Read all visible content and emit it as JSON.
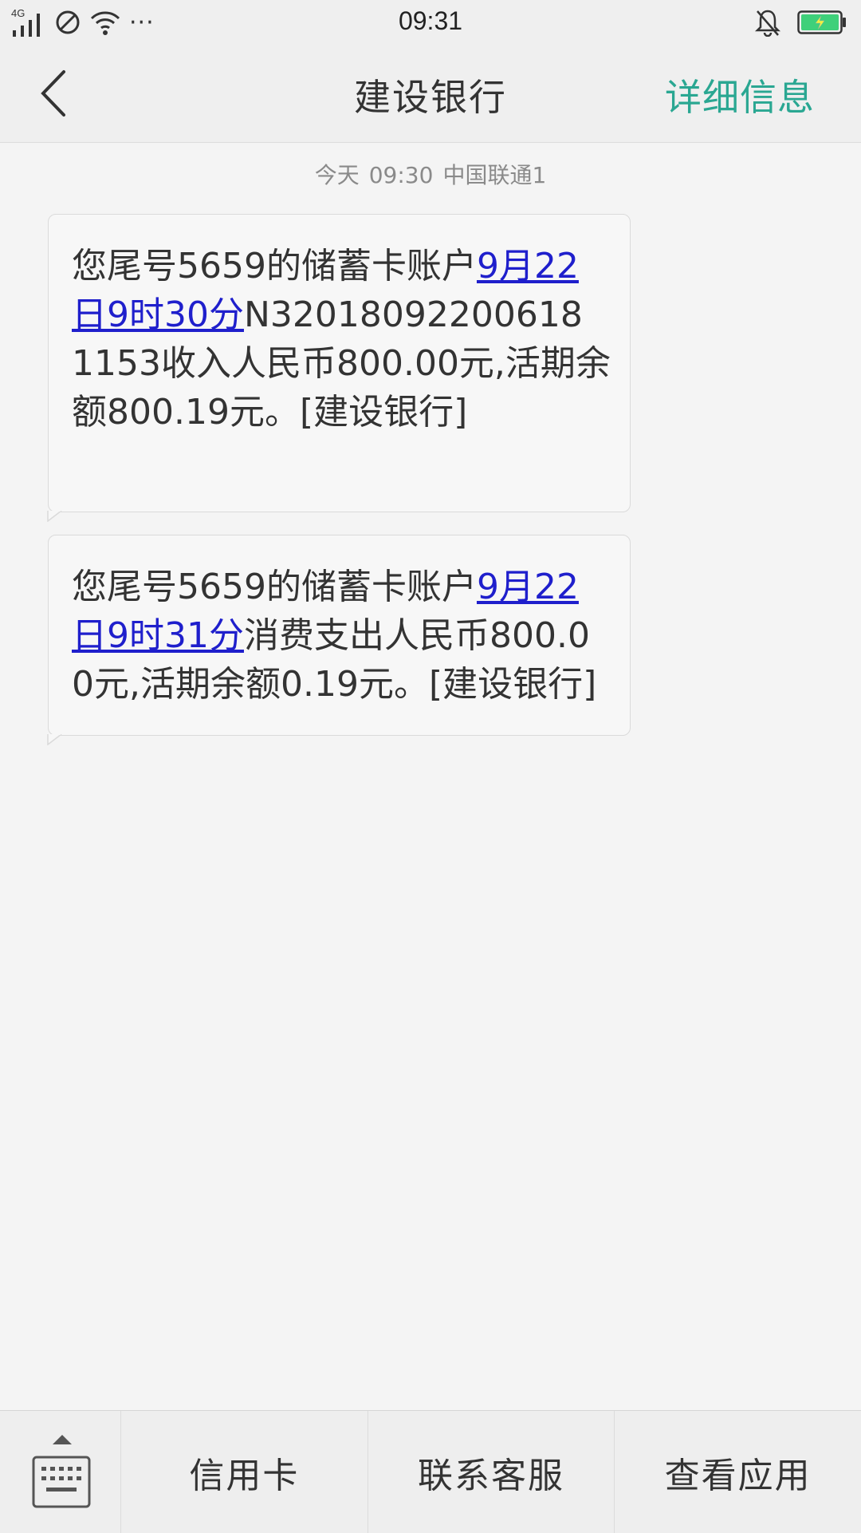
{
  "status_bar": {
    "network": "4G",
    "time": "09:31",
    "more": "···"
  },
  "header": {
    "title": "建设银行",
    "detail_label": "详细信息"
  },
  "thread": {
    "date_label": "今天",
    "time": "09:30",
    "sim": "中国联通1"
  },
  "messages": [
    {
      "prefix": "您尾号5659的储蓄卡账户",
      "link": "9月22日9时30分",
      "suffix": "N32018092200618 1153收入人民币800.00元,活期余额800.19元。[建设银行]"
    },
    {
      "prefix": "您尾号5659的储蓄卡账户",
      "link": "9月22日9时31分",
      "suffix": "消费支出人民币800.00元,活期余额0.19元。[建设银行]"
    }
  ],
  "bottom_menu": {
    "items": [
      "信用卡",
      "联系客服",
      "查看应用"
    ]
  },
  "colors": {
    "accent": "#2aa792",
    "link": "#1f1fcc",
    "battery": "#3fd07a"
  }
}
